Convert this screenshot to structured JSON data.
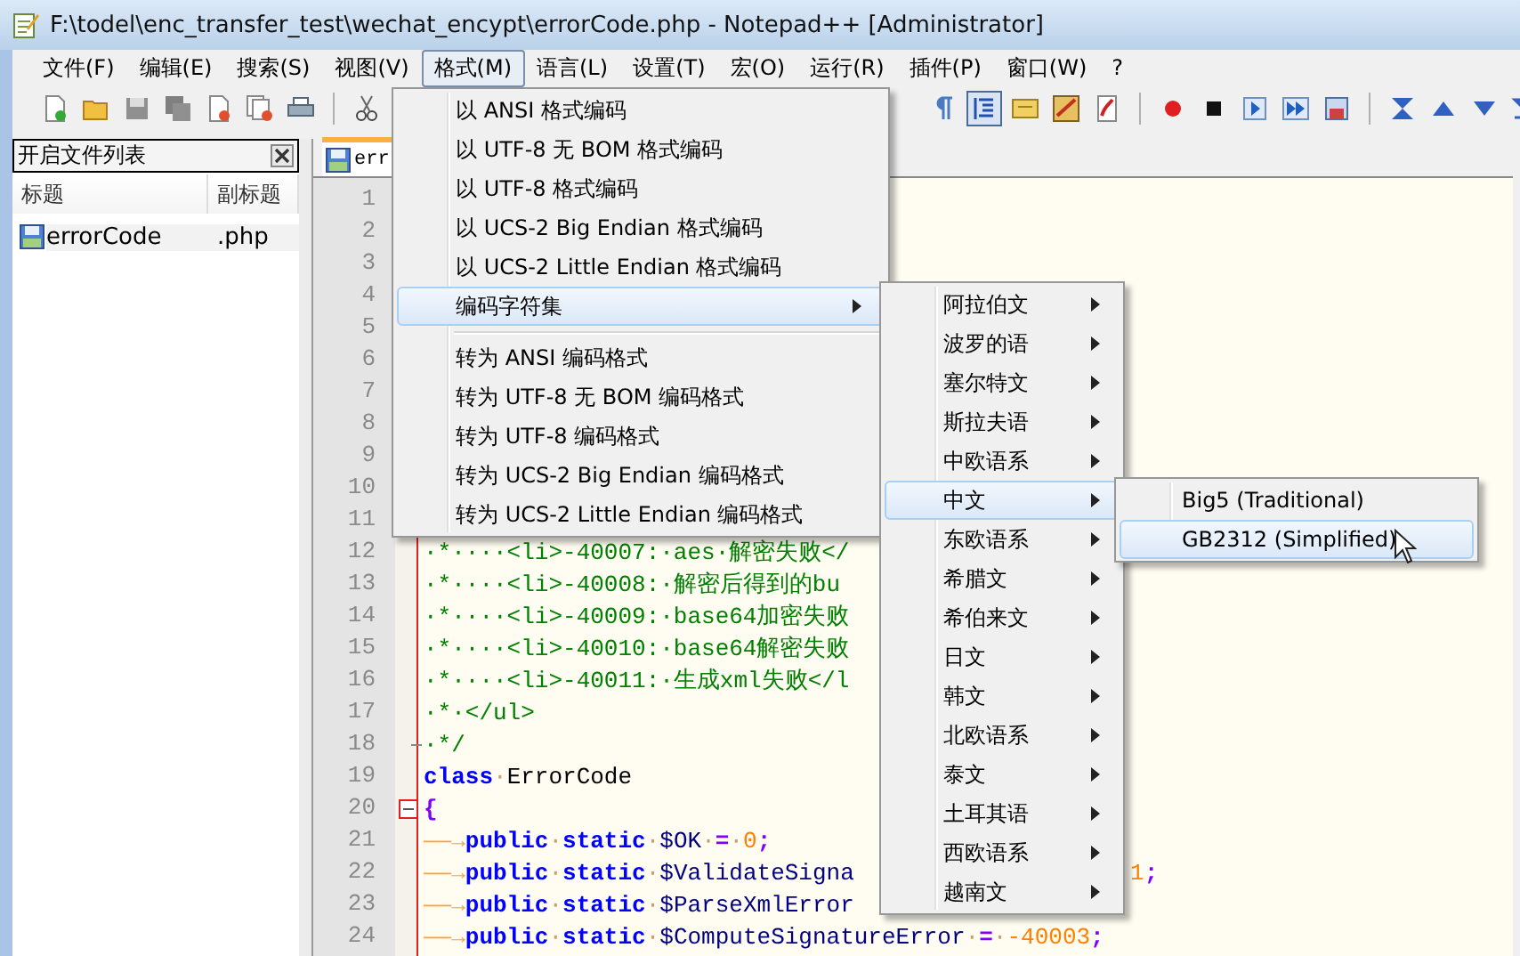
{
  "window": {
    "title": "F:\\todel\\enc_transfer_test\\wechat_encypt\\errorCode.php - Notepad++ [Administrator]"
  },
  "menu_bar": [
    {
      "label": "文件(F)",
      "selected": false
    },
    {
      "label": "编辑(E)",
      "selected": false
    },
    {
      "label": "搜索(S)",
      "selected": false
    },
    {
      "label": "视图(V)",
      "selected": false
    },
    {
      "label": "格式(M)",
      "selected": true
    },
    {
      "label": "语言(L)",
      "selected": false
    },
    {
      "label": "设置(T)",
      "selected": false
    },
    {
      "label": "宏(O)",
      "selected": false
    },
    {
      "label": "运行(R)",
      "selected": false
    },
    {
      "label": "插件(P)",
      "selected": false
    },
    {
      "label": "窗口(W)",
      "selected": false
    },
    {
      "label": "?",
      "selected": false
    }
  ],
  "toolbar_left": [
    {
      "kind": "new",
      "pressed": false
    },
    {
      "kind": "open",
      "pressed": false
    },
    {
      "kind": "save",
      "pressed": false
    },
    {
      "kind": "save-all",
      "pressed": false
    },
    {
      "kind": "close",
      "pressed": false
    },
    {
      "kind": "close-all",
      "pressed": false
    },
    {
      "kind": "print",
      "pressed": false
    },
    {
      "kind": "separator"
    },
    {
      "kind": "cut",
      "pressed": false
    }
  ],
  "toolbar_right": [
    {
      "kind": "pilcrow",
      "pressed": false
    },
    {
      "kind": "indent-guide",
      "pressed": true
    },
    {
      "kind": "note",
      "pressed": false
    },
    {
      "kind": "map",
      "pressed": false
    },
    {
      "kind": "script",
      "pressed": false
    },
    {
      "kind": "separator"
    },
    {
      "kind": "record",
      "pressed": false
    },
    {
      "kind": "stop",
      "pressed": false
    },
    {
      "kind": "play",
      "pressed": false
    },
    {
      "kind": "play-multi",
      "pressed": false
    },
    {
      "kind": "save-macro",
      "pressed": false
    },
    {
      "kind": "separator"
    },
    {
      "kind": "sync-v",
      "pressed": false
    },
    {
      "kind": "up",
      "pressed": false
    },
    {
      "kind": "down",
      "pressed": false
    },
    {
      "kind": "sync-h",
      "pressed": false
    }
  ],
  "file_panel": {
    "title": "开启文件列表",
    "columns": [
      "标题",
      "副标题"
    ],
    "rows": [
      {
        "name": "errorCode",
        "ext": ".php",
        "selected": true
      }
    ]
  },
  "editor": {
    "tabs": [
      {
        "label": "err",
        "selected": true
      }
    ],
    "lines": [
      {
        "number": "1"
      },
      {
        "number": "2"
      },
      {
        "number": "3"
      },
      {
        "number": "4"
      },
      {
        "number": "5"
      },
      {
        "number": "6"
      },
      {
        "number": "7"
      },
      {
        "number": "8"
      },
      {
        "number": "9"
      },
      {
        "number": "10"
      },
      {
        "number": "11"
      },
      {
        "number": "12",
        "tokens": [
          {
            "kind": "comment",
            "text": "·*····<li>-40007:·aes·解密失败</"
          }
        ]
      },
      {
        "number": "13",
        "tokens": [
          {
            "kind": "comment",
            "text": "·*····<li>-40008:·解密后得到的bu"
          }
        ]
      },
      {
        "number": "14",
        "tokens": [
          {
            "kind": "comment",
            "text": "·*····<li>-40009:·base64加密失败"
          }
        ]
      },
      {
        "number": "15",
        "tokens": [
          {
            "kind": "comment",
            "text": "·*····<li>-40010:·base64解密失败"
          }
        ]
      },
      {
        "number": "16",
        "tokens": [
          {
            "kind": "comment",
            "text": "·*····<li>-40011:·生成xml失败</l"
          }
        ]
      },
      {
        "number": "17",
        "tokens": [
          {
            "kind": "comment",
            "text": "·*·</ul>"
          }
        ]
      },
      {
        "number": "18",
        "fold_end": true,
        "tokens": [
          {
            "kind": "comment",
            "text": "·*/"
          }
        ]
      },
      {
        "number": "19",
        "tokens": [
          {
            "kind": "keyword",
            "text": "class"
          },
          {
            "kind": "space",
            "text": "·"
          },
          {
            "kind": "plain",
            "text": "ErrorCode"
          }
        ]
      },
      {
        "number": "20",
        "fold_start": true,
        "tokens": [
          {
            "kind": "operator",
            "text": "{"
          }
        ]
      },
      {
        "number": "21",
        "tokens": [
          {
            "kind": "tab",
            "text": "——→"
          },
          {
            "kind": "keyword",
            "text": "public"
          },
          {
            "kind": "space",
            "text": "·"
          },
          {
            "kind": "keyword",
            "text": "static"
          },
          {
            "kind": "space",
            "text": "·"
          },
          {
            "kind": "variable",
            "text": "$OK"
          },
          {
            "kind": "space",
            "text": "·"
          },
          {
            "kind": "operator",
            "text": "="
          },
          {
            "kind": "space",
            "text": "·"
          },
          {
            "kind": "number",
            "text": "0"
          },
          {
            "kind": "operator",
            "text": ";"
          }
        ]
      },
      {
        "number": "22",
        "tokens": [
          {
            "kind": "tab",
            "text": "——→"
          },
          {
            "kind": "keyword",
            "text": "public"
          },
          {
            "kind": "space",
            "text": "·"
          },
          {
            "kind": "keyword",
            "text": "static"
          },
          {
            "kind": "space",
            "text": "·"
          },
          {
            "kind": "variable",
            "text": "$ValidateSigna"
          }
        ],
        "tail": [
          {
            "kind": "number",
            "text": "1"
          },
          {
            "kind": "operator",
            "text": ";"
          }
        ]
      },
      {
        "number": "23",
        "tokens": [
          {
            "kind": "tab",
            "text": "——→"
          },
          {
            "kind": "keyword",
            "text": "public"
          },
          {
            "kind": "space",
            "text": "·"
          },
          {
            "kind": "keyword",
            "text": "static"
          },
          {
            "kind": "space",
            "text": "·"
          },
          {
            "kind": "variable",
            "text": "$ParseXmlError"
          }
        ]
      },
      {
        "number": "24",
        "tokens": [
          {
            "kind": "tab",
            "text": "——→"
          },
          {
            "kind": "keyword",
            "text": "public"
          },
          {
            "kind": "space",
            "text": "·"
          },
          {
            "kind": "keyword",
            "text": "static"
          },
          {
            "kind": "space",
            "text": "·"
          },
          {
            "kind": "variable",
            "text": "$ComputeSignatureError"
          },
          {
            "kind": "space",
            "text": "·"
          },
          {
            "kind": "operator",
            "text": "="
          },
          {
            "kind": "space",
            "text": "·"
          },
          {
            "kind": "number",
            "text": "-40003"
          },
          {
            "kind": "operator",
            "text": ";"
          }
        ]
      }
    ]
  },
  "format_menu": {
    "items": [
      {
        "kind": "item",
        "label": "以 ANSI 格式编码",
        "selected": false
      },
      {
        "kind": "item",
        "label": "以 UTF-8 无 BOM 格式编码",
        "selected": false
      },
      {
        "kind": "item",
        "label": "以 UTF-8 格式编码",
        "selected": false
      },
      {
        "kind": "item",
        "label": "以 UCS-2 Big Endian 格式编码",
        "selected": false
      },
      {
        "kind": "item",
        "label": "以 UCS-2 Little Endian 格式编码",
        "selected": false
      },
      {
        "kind": "submenu",
        "label": "编码字符集",
        "selected": true
      },
      {
        "kind": "separator"
      },
      {
        "kind": "item",
        "label": "转为 ANSI 编码格式",
        "selected": false
      },
      {
        "kind": "item",
        "label": "转为 UTF-8 无 BOM 编码格式",
        "selected": false
      },
      {
        "kind": "item",
        "label": "转为 UTF-8 编码格式",
        "selected": false
      },
      {
        "kind": "item",
        "label": "转为 UCS-2 Big Endian 编码格式",
        "selected": false
      },
      {
        "kind": "item",
        "label": "转为 UCS-2 Little Endian 编码格式",
        "selected": false
      }
    ]
  },
  "charset_menu": {
    "items": [
      {
        "label": "阿拉伯文",
        "selected": false
      },
      {
        "label": "波罗的语",
        "selected": false
      },
      {
        "label": "塞尔特文",
        "selected": false
      },
      {
        "label": "斯拉夫语",
        "selected": false
      },
      {
        "label": "中欧语系",
        "selected": false
      },
      {
        "label": "中文",
        "selected": true
      },
      {
        "label": "东欧语系",
        "selected": false
      },
      {
        "label": "希腊文",
        "selected": false
      },
      {
        "label": "希伯来文",
        "selected": false
      },
      {
        "label": "日文",
        "selected": false
      },
      {
        "label": "韩文",
        "selected": false
      },
      {
        "label": "北欧语系",
        "selected": false
      },
      {
        "label": "泰文",
        "selected": false
      },
      {
        "label": "土耳其语",
        "selected": false
      },
      {
        "label": "西欧语系",
        "selected": false
      },
      {
        "label": "越南文",
        "selected": false
      }
    ]
  },
  "chinese_menu": {
    "items": [
      {
        "label": "Big5 (Traditional)",
        "selected": false
      },
      {
        "label": "GB2312 (Simplified)",
        "selected": true
      }
    ]
  }
}
